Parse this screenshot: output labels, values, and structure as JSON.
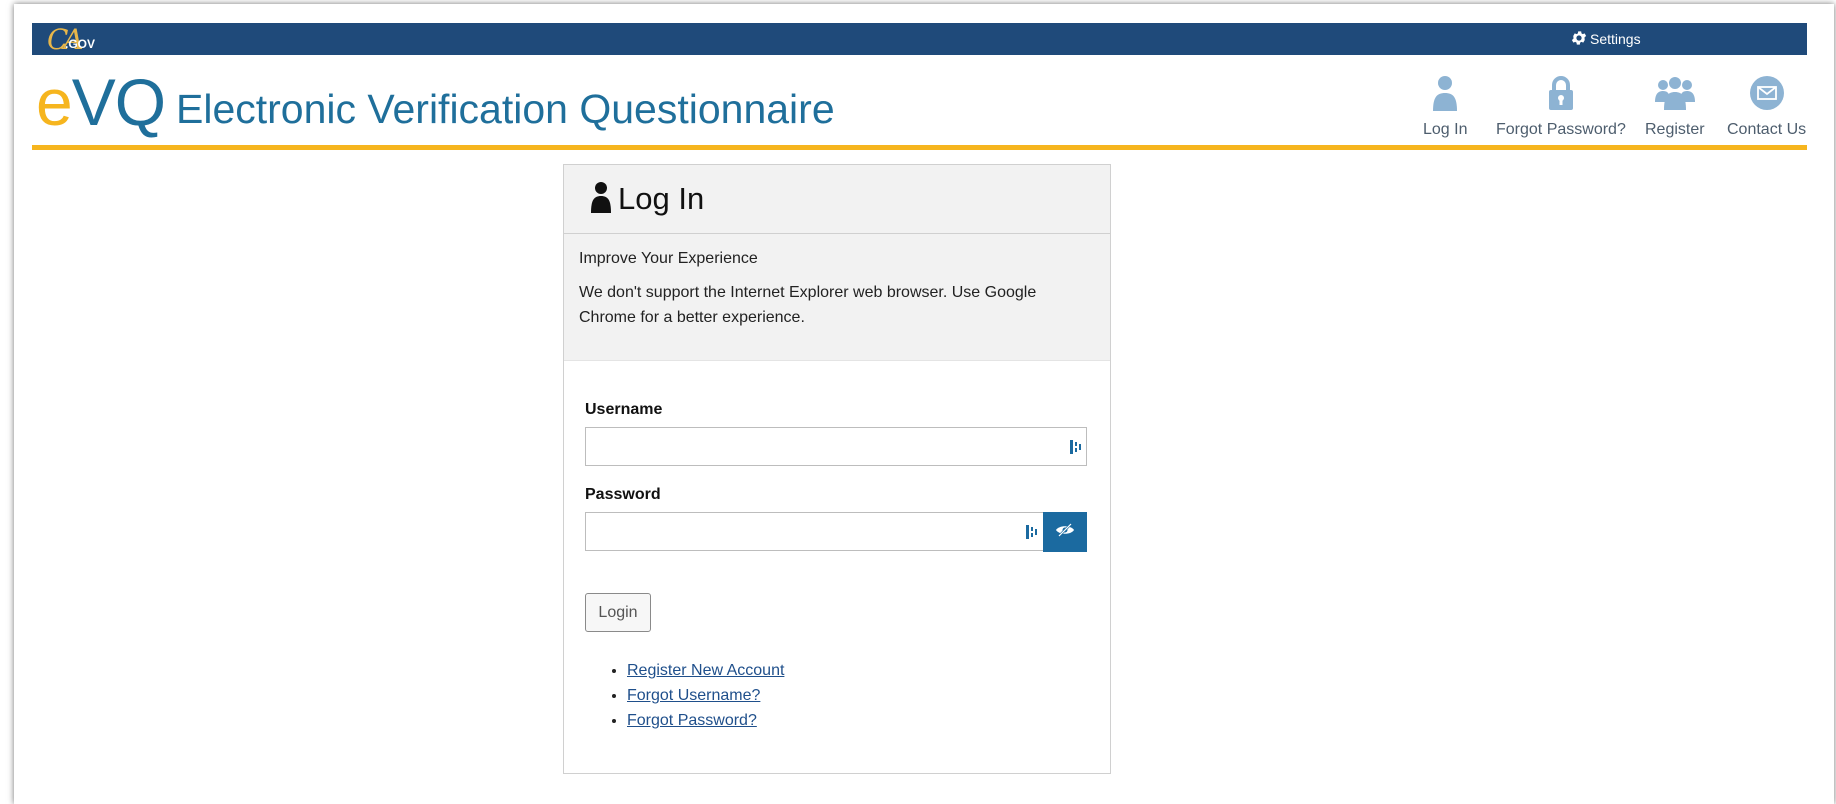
{
  "topbar": {
    "logo": {
      "ca": "CA",
      "gov": ".GOV"
    },
    "settings_label": "Settings",
    "settings_icon": "gear-icon"
  },
  "header": {
    "brand_e": "e",
    "brand_vq": "VQ",
    "title": "Electronic Verification Questionnaire",
    "nav": [
      {
        "label": "Log In",
        "icon": "user-icon"
      },
      {
        "label": "Forgot Password?",
        "icon": "lock-icon"
      },
      {
        "label": "Register",
        "icon": "users-icon"
      },
      {
        "label": "Contact Us",
        "icon": "envelope-icon"
      }
    ]
  },
  "login": {
    "title": "Log In",
    "notice_title": "Improve Your Experience",
    "notice_body": "We don't support the Internet Explorer web browser. Use Google Chrome for a better experience.",
    "username_label": "Username",
    "username_value": "",
    "password_label": "Password",
    "password_value": "",
    "login_button": "Login",
    "links": [
      "Register New Account",
      "Forgot Username?",
      "Forgot Password?"
    ]
  },
  "colors": {
    "topbar": "#1f4a7a",
    "accent_gold": "#f6b51e",
    "brand_blue": "#1f6f9b",
    "nav_icon": "#8db3d3",
    "eye_button": "#1b6aa0",
    "link": "#1f4f8b"
  }
}
